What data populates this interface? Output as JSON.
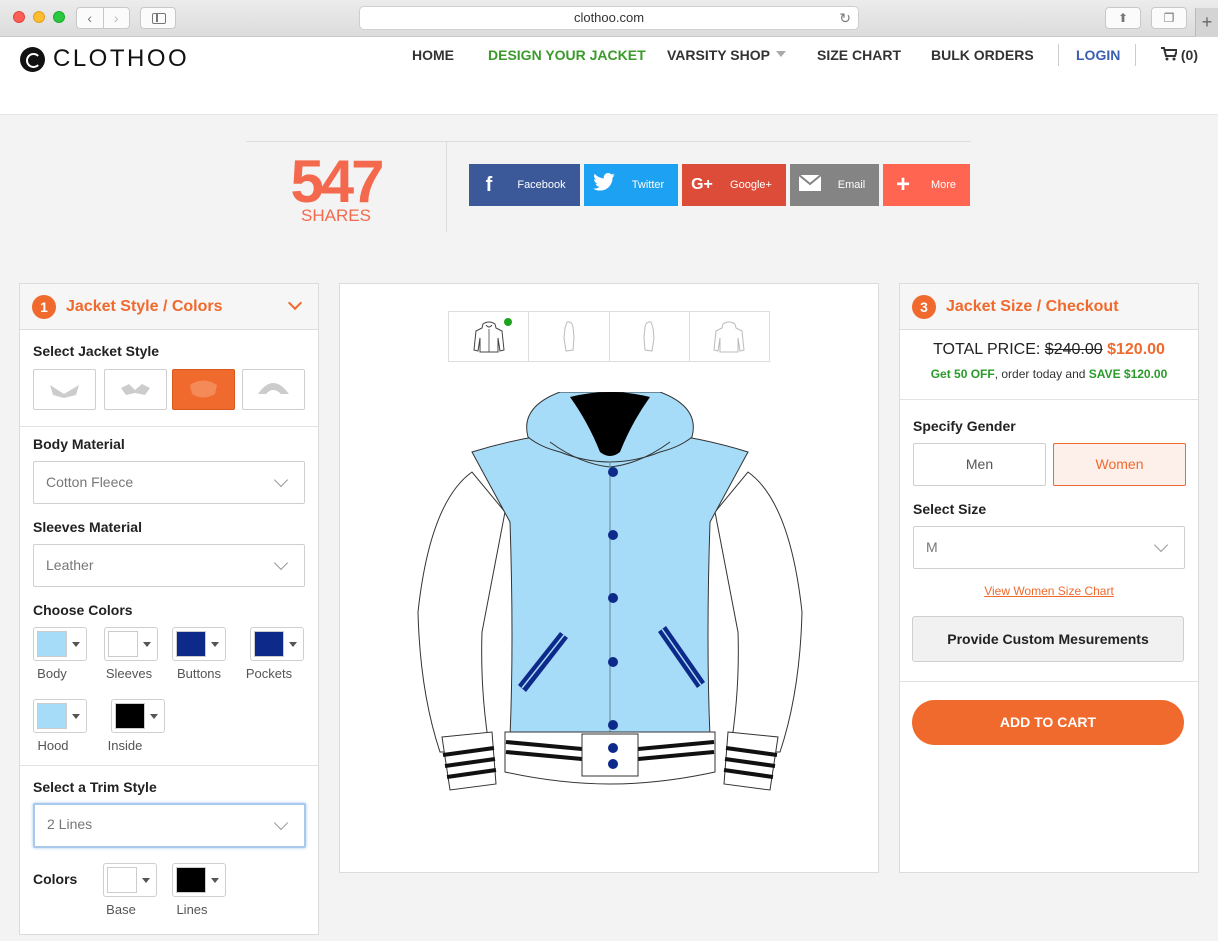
{
  "browser": {
    "url": "clothoo.com"
  },
  "header": {
    "logo_text": "CLOTHOO",
    "nav": {
      "home": "HOME",
      "design": "DESIGN YOUR JACKET",
      "varsity": "VARSITY SHOP",
      "size_chart": "SIZE CHART",
      "bulk": "BULK ORDERS",
      "login": "LOGIN",
      "cart": "(0)"
    }
  },
  "shares": {
    "count": "547",
    "label": "SHARES",
    "buttons": [
      {
        "label": "Facebook",
        "icon": "facebook-icon",
        "color": "#3b5998"
      },
      {
        "label": "Twitter",
        "icon": "twitter-icon",
        "color": "#1da1f2"
      },
      {
        "label": "Google+",
        "icon": "google-plus-icon",
        "color": "#dd4b39"
      },
      {
        "label": "Email",
        "icon": "email-icon",
        "color": "#848484"
      },
      {
        "label": "More",
        "icon": "plus-icon",
        "color": "#ff6550"
      }
    ]
  },
  "left_panel": {
    "step": "1",
    "title": "Jacket Style / Colors",
    "select_style_label": "Select Jacket Style",
    "body_material_label": "Body Material",
    "body_material_value": "Cotton Fleece",
    "sleeves_material_label": "Sleeves Material",
    "sleeves_material_value": "Leather",
    "choose_colors_label": "Choose Colors",
    "colors": [
      {
        "label": "Body",
        "color": "#a6dcf8"
      },
      {
        "label": "Sleeves",
        "color": "#ffffff"
      },
      {
        "label": "Buttons",
        "color": "#0d2a8a"
      },
      {
        "label": "Pockets",
        "color": "#0d2a8a"
      },
      {
        "label": "Hood",
        "color": "#a6dcf8"
      },
      {
        "label": "Inside",
        "color": "#000000"
      }
    ],
    "trim_label": "Select a Trim Style",
    "trim_value": "2 Lines",
    "trim_colors_label": "Colors",
    "trim_colors": [
      {
        "label": "Base",
        "color": "#ffffff"
      },
      {
        "label": "Lines",
        "color": "#000000"
      }
    ]
  },
  "right_panel": {
    "step": "3",
    "title": "Jacket Size / Checkout",
    "total_label": "TOTAL PRICE:",
    "old_price": "$240.00",
    "new_price": "$120.00",
    "promo_a": "Get 50 OFF",
    "promo_b": ", order today and ",
    "promo_c": "SAVE $120.00",
    "gender_label": "Specify Gender",
    "gender_men": "Men",
    "gender_women": "Women",
    "size_label": "Select Size",
    "size_value": "M",
    "size_chart_link": "View Women Size Chart",
    "custom_button": "Provide Custom Mesurements",
    "add_to_cart": "ADD TO CART"
  },
  "accent_color": "#f06a2e"
}
